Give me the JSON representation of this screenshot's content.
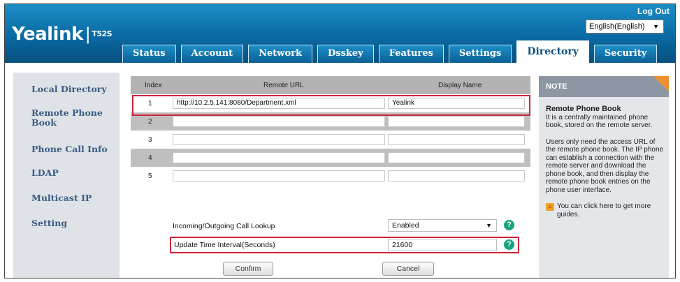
{
  "header": {
    "brand": "Yealink",
    "model": "T52S",
    "logout_label": "Log Out",
    "language": "English(English)"
  },
  "tabs": [
    {
      "label": "Status",
      "active": false
    },
    {
      "label": "Account",
      "active": false
    },
    {
      "label": "Network",
      "active": false
    },
    {
      "label": "Dsskey",
      "active": false
    },
    {
      "label": "Features",
      "active": false
    },
    {
      "label": "Settings",
      "active": false
    },
    {
      "label": "Directory",
      "active": true
    },
    {
      "label": "Security",
      "active": false
    }
  ],
  "sidebar": {
    "items": [
      {
        "label": "Local Directory",
        "selected": false
      },
      {
        "label": "Remote Phone Book",
        "selected": true
      },
      {
        "label": "Phone Call Info",
        "selected": false
      },
      {
        "label": "LDAP",
        "selected": false
      },
      {
        "label": "Multicast IP",
        "selected": false
      },
      {
        "label": "Setting",
        "selected": false
      }
    ]
  },
  "table": {
    "headers": {
      "index": "Index",
      "url": "Remote URL",
      "display": "Display Name"
    },
    "rows": [
      {
        "index": "1",
        "url": "http://10.2.5.141:8080/Department.xml",
        "display": "Yealink"
      },
      {
        "index": "2",
        "url": "",
        "display": ""
      },
      {
        "index": "3",
        "url": "",
        "display": ""
      },
      {
        "index": "4",
        "url": "",
        "display": ""
      },
      {
        "index": "5",
        "url": "",
        "display": ""
      }
    ]
  },
  "form": {
    "lookup_label": "Incoming/Outgoing Call Lookup",
    "lookup_value": "Enabled",
    "interval_label": "Update Time Interval(Seconds)",
    "interval_value": "21600",
    "confirm_label": "Confirm",
    "cancel_label": "Cancel",
    "help_glyph": "?"
  },
  "note": {
    "title": "NOTE",
    "section_title": "Remote Phone Book",
    "section_text": "It is a centrally maintained phone book, stored on the remote server.",
    "paragraph": "Users only need the access URL of the remote phone book. The IP phone can establish a connection with the remote server and download the phone book, and then display the remote phone book entries on the phone user interface.",
    "guide_text": "You can click here to get more guides."
  },
  "colors": {
    "header_blue": "#0a6aa3",
    "highlight_red": "#d0243a",
    "help_green": "#18a37f",
    "note_orange": "#f0902c"
  }
}
